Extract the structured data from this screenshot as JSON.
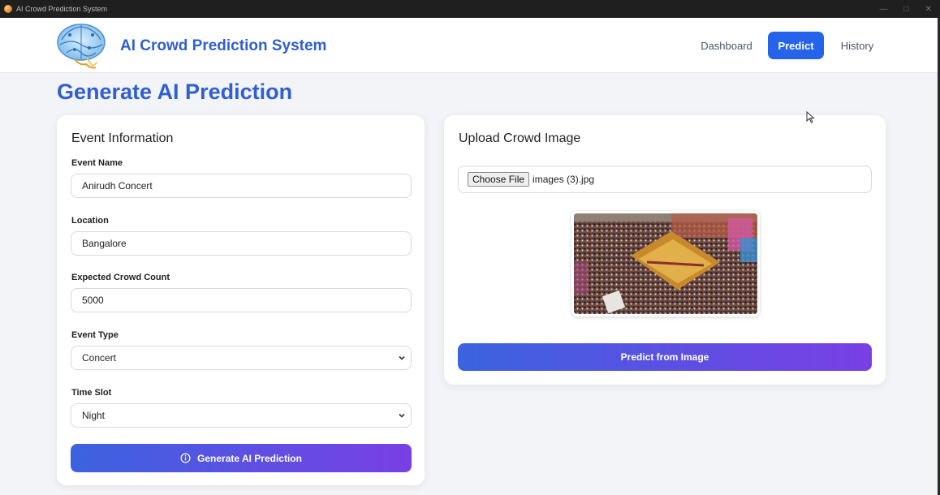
{
  "window": {
    "title": "AI Crowd Prediction System"
  },
  "header": {
    "brand": "AI Crowd Prediction System",
    "nav": [
      {
        "label": "Dashboard",
        "active": false
      },
      {
        "label": "Predict",
        "active": true
      },
      {
        "label": "History",
        "active": false
      }
    ]
  },
  "page": {
    "title": "Generate AI Prediction"
  },
  "event_form": {
    "heading": "Event Information",
    "event_name": {
      "label": "Event Name",
      "value": "Anirudh Concert"
    },
    "location": {
      "label": "Location",
      "value": "Bangalore"
    },
    "crowd_count": {
      "label": "Expected Crowd Count",
      "value": "5000"
    },
    "event_type": {
      "label": "Event Type",
      "value": "Concert"
    },
    "time_slot": {
      "label": "Time Slot",
      "value": "Night"
    },
    "submit_label": "Generate AI Prediction"
  },
  "upload": {
    "heading": "Upload Crowd Image",
    "choose_label": "Choose File",
    "file_name": "images (3).jpg",
    "submit_label": "Predict from Image"
  },
  "colors": {
    "brand": "#2f5fd0",
    "nav_active": "#2563eb",
    "gradient_start": "#3b63e0",
    "gradient_end": "#7a3fe4"
  },
  "icons": {
    "logo": "brain-circuit-logo",
    "generate_button": "info-circle-icon",
    "select": "chevron-down-icon"
  }
}
